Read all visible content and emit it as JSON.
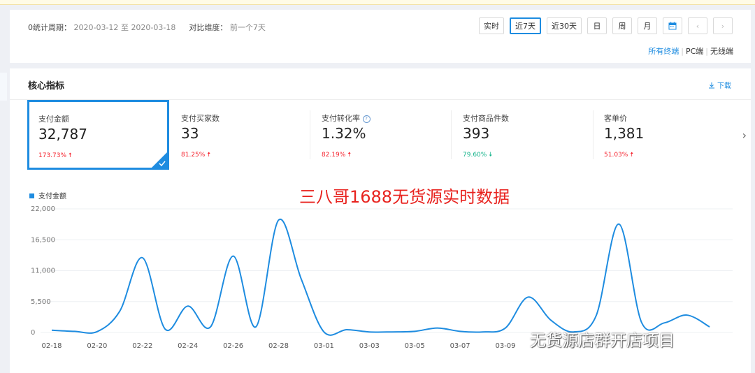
{
  "filter": {
    "period_label": "0统计周期：",
    "start_date": "2020-03-12",
    "date_sep": "至",
    "end_date": "2020-03-18",
    "compare_label": "对比维度：",
    "compare_value": "前一个7天",
    "buttons": [
      "实时",
      "近7天",
      "近30天",
      "日",
      "周",
      "月"
    ],
    "active_button": "近7天",
    "calendar_icon": "calendar-icon",
    "prev_icon": "chevron-left-icon",
    "next_icon": "chevron-right-icon",
    "devices": [
      "所有终端",
      "PC端",
      "无线端"
    ],
    "active_device": "所有终端"
  },
  "core": {
    "title": "核心指标",
    "download_label": "下载",
    "download_icon": "download-icon",
    "metrics": [
      {
        "label": "支付金额",
        "value": "32,787",
        "change": "173.73%",
        "direction": "up",
        "selected": true
      },
      {
        "label": "支付买家数",
        "value": "33",
        "change": "81.25%",
        "direction": "up"
      },
      {
        "label": "支付转化率",
        "value": "1.32%",
        "change": "82.19%",
        "direction": "up",
        "help": true
      },
      {
        "label": "支付商品件数",
        "value": "393",
        "change": "79.60%",
        "direction": "down"
      },
      {
        "label": "客单价",
        "value": "1,381",
        "change": "51.03%",
        "direction": "up"
      }
    ],
    "next_icon": "chevron-right-icon"
  },
  "colors": {
    "accent": "#1e8ce0",
    "up": "#f5222d",
    "down": "#13b38a",
    "overlay": "#e8231f"
  },
  "overlay_text": "三八哥1688无货源实时数据",
  "watermark_text": "无货源店群开店项目",
  "chart_data": {
    "type": "line",
    "series": [
      {
        "name": "支付金额",
        "values": [
          400,
          200,
          150,
          3800,
          13300,
          600,
          4700,
          1000,
          13600,
          1000,
          20000,
          9500,
          100,
          500,
          100,
          100,
          200,
          800,
          200,
          100,
          800,
          6300,
          2200,
          100,
          3000,
          19300,
          1800,
          1700,
          3100,
          1000
        ]
      }
    ],
    "x_tick_labels": [
      "02-18",
      "02-20",
      "02-22",
      "02-24",
      "02-26",
      "02-28",
      "03-01",
      "03-03",
      "03-05",
      "03-07",
      "03-09"
    ],
    "x_tick_positions": [
      0,
      2,
      4,
      6,
      8,
      10,
      12,
      14,
      16,
      18,
      20
    ],
    "y_ticks": [
      0,
      5500,
      11000,
      16500,
      22000
    ],
    "y_tick_labels": [
      "0",
      "5,500",
      "11,000",
      "16,500",
      "22,000"
    ],
    "ylim": [
      0,
      22000
    ],
    "grid": true,
    "legend_position": "top-left"
  }
}
